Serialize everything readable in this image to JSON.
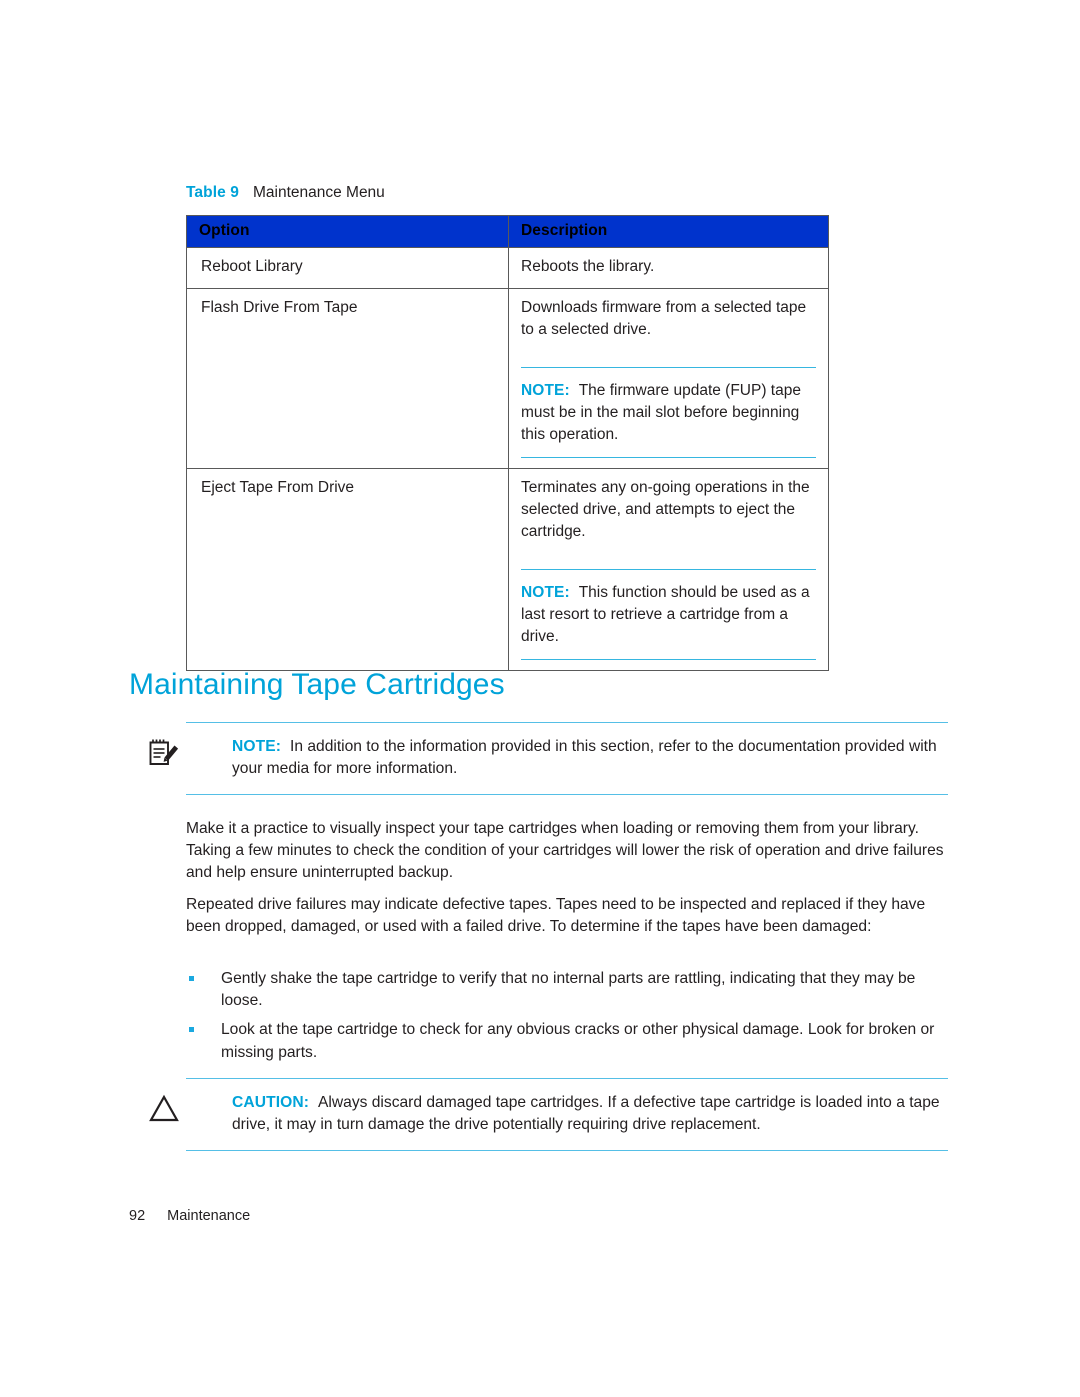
{
  "colors": {
    "accent_cyan": "#00a3d9",
    "rule_cyan": "#55bfe6",
    "table_header_blue": "#0033cc",
    "body_text": "#231f20"
  },
  "table": {
    "caption_label": "Table 9",
    "caption_title": "Maintenance Menu",
    "headers": [
      "Option",
      "Description"
    ],
    "rows": [
      {
        "option": "Reboot Library",
        "description": "Reboots the library.",
        "note": null
      },
      {
        "option": "Flash Drive From Tape",
        "description": "Downloads firmware from a selected tape to a selected drive.",
        "note": {
          "keyword": "NOTE:",
          "text": "The firmware update (FUP) tape must be in the mail slot before beginning this operation."
        }
      },
      {
        "option": "Eject Tape From Drive",
        "description": "Terminates any on-going operations in the selected drive, and attempts to eject the cartridge.",
        "note": {
          "keyword": "NOTE:",
          "text": "This function should be used as a last resort to retrieve a cartridge from a drive."
        }
      }
    ]
  },
  "section": {
    "heading": "Maintaining Tape Cartridges"
  },
  "note_block": {
    "icon": "notepad-pencil-icon",
    "keyword": "NOTE:",
    "text": "In addition to the information provided in this section, refer to the documentation provided with your media for more information."
  },
  "paragraphs": [
    "Make it a practice to visually inspect your tape cartridges when loading or removing them from your library. Taking a few minutes to check the condition of your cartridges will lower the risk of operation and drive failures and help ensure uninterrupted backup.",
    "Repeated drive failures may indicate defective tapes. Tapes need to be inspected and replaced if they have been dropped, damaged, or used with a failed drive. To determine if the tapes have been damaged:"
  ],
  "bullets": [
    "Gently shake the tape cartridge to verify that no internal parts are rattling, indicating that they may be loose.",
    "Look at the tape cartridge to check for any obvious cracks or other physical damage. Look for broken or missing parts."
  ],
  "caution_block": {
    "icon": "warning-triangle-icon",
    "keyword": "CAUTION:",
    "text": "Always discard damaged tape cartridges. If a defective tape cartridge is loaded into a tape drive, it may in turn damage the drive potentially requiring drive replacement."
  },
  "footer": {
    "page_number": "92",
    "section_name": "Maintenance"
  }
}
